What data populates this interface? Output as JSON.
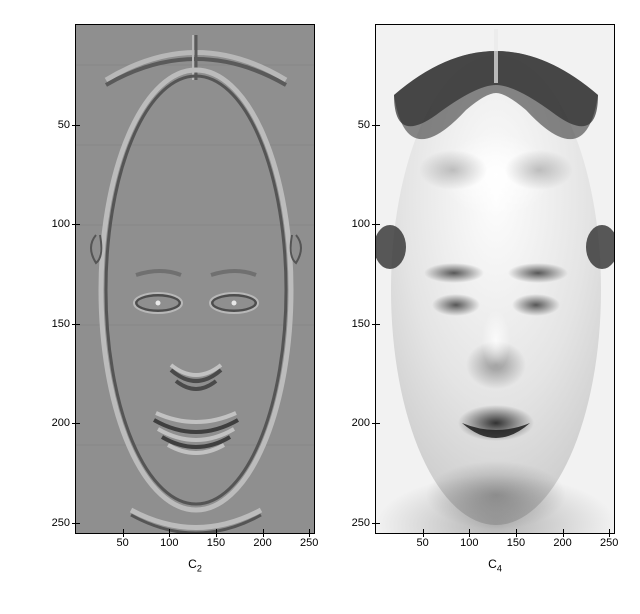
{
  "y_ticks": [
    "50",
    "100",
    "150",
    "200",
    "250"
  ],
  "x_ticks": [
    "50",
    "100",
    "150",
    "200",
    "250"
  ],
  "panels": {
    "left": {
      "label_base": "C",
      "label_sub": "2"
    },
    "right": {
      "label_base": "C",
      "label_sub": "4"
    }
  },
  "chart_data": [
    {
      "type": "heatmap",
      "title": "C_2",
      "xlabel": "C_2",
      "ylabel": "",
      "xlim": [
        1,
        256
      ],
      "ylim": [
        1,
        256
      ],
      "description": "High-pass / edge-filtered face image (Noh mask), mid-gray baseline with outlined facial contours (hairline, face oval, eyes, nose, mouth, ears)."
    },
    {
      "type": "heatmap",
      "title": "C_4",
      "xlabel": "C_4",
      "ylabel": "",
      "xlim": [
        1,
        256
      ],
      "ylim": [
        1,
        256
      ],
      "description": "Low-pass / blurred face image (Noh mask), smooth shading with dark hair, soft eyes/brows, nose shading and open dark mouth."
    }
  ]
}
